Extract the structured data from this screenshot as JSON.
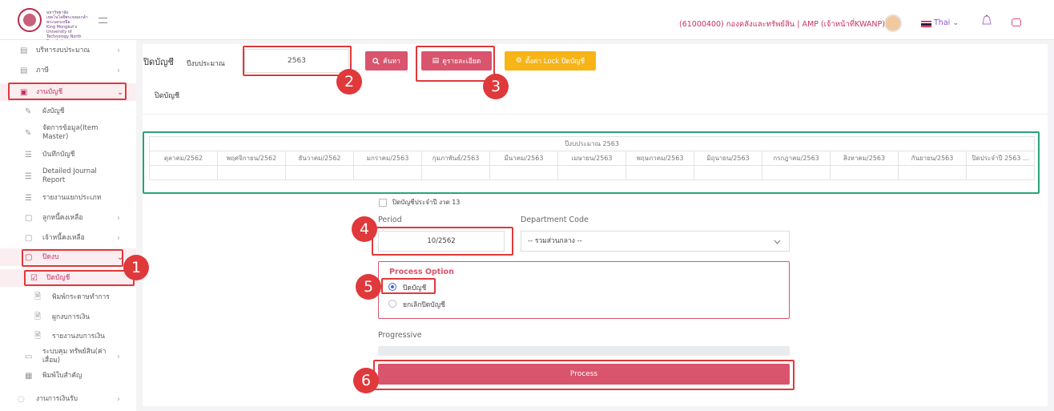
{
  "header": {
    "university_lines": [
      "มหาวิทยาลัย",
      "เทคโนโลยีพระจอมเกล้าพระนครเหนือ",
      "King Mongkut's University of",
      "Technology North Bangkok"
    ],
    "user_text": "(61000400) กองคลังและทรัพย์สิน | AMP (เจ้าหน้าที่KWANP)",
    "language": "Thai",
    "language_caret": "⌄"
  },
  "sidebar": {
    "items": [
      {
        "label": "บริหารงบประมาณ",
        "icon": "ledger-icon",
        "chevron": "›"
      },
      {
        "label": "ภาษี",
        "icon": "ledger-icon",
        "chevron": "›"
      },
      {
        "label": "งานบัญชี",
        "icon": "folder-icon",
        "chevron": "⌄"
      },
      {
        "label": "ผังบัญชี",
        "icon": "edit-doc-icon"
      },
      {
        "label": "จัดการข้อมูล(Item Master)",
        "icon": "edit-doc-icon"
      },
      {
        "label": "บันทึกบัญชี",
        "icon": "list-icon"
      },
      {
        "label": "Detailed Journal Report",
        "icon": "list-icon"
      },
      {
        "label": "รายงานแยกประเภท",
        "icon": "list-icon"
      },
      {
        "label": "ลูกหนี้คงเหลือ",
        "icon": "doc-icon",
        "chevron": "›"
      },
      {
        "label": "เจ้าหนี้คงเหลือ",
        "icon": "doc-icon",
        "chevron": "›"
      },
      {
        "label": "ปิดงบ",
        "icon": "doc-icon",
        "chevron": "⌄"
      },
      {
        "label": "ปิดบัญชี",
        "icon": "check-square-icon"
      },
      {
        "label": "พิมพ์กระดาษทำการ",
        "icon": "file-icon"
      },
      {
        "label": "ผูกงบการเงิน",
        "icon": "file-icon"
      },
      {
        "label": "รายงานงบการเงิน",
        "icon": "file-icon"
      },
      {
        "label": "ระบบคุม ทรัพย์สิน(ค่าเสื่อม)",
        "icon": "box-icon",
        "chevron": "›"
      },
      {
        "label": "พิมพ์ใบสำคัญ",
        "icon": "print-icon"
      },
      {
        "label": "งานการเงินรับ",
        "icon": "coin-icon",
        "chevron": "›"
      }
    ]
  },
  "toolbar": {
    "page_title": "ปิดบัญชี",
    "year_label": "ปีงบประมาณ",
    "year_value": "2563",
    "search_label": "ค้นหา",
    "detail_label": "ดูรายละเอียด",
    "lock_label": "ตั้งค่า Lock ปิดบัญชี"
  },
  "card": {
    "title": "ปิดบัญชี"
  },
  "table": {
    "header": "ปีงบประมาณ 2563",
    "months": [
      "ตุลาคม/2562",
      "พฤศจิกายน/2562",
      "ธันวาคม/2562",
      "มกราคม/2563",
      "กุมภาพันธ์/2563",
      "มีนาคม/2563",
      "เมษายน/2563",
      "พฤษภาคม/2563",
      "มิถุนายน/2563",
      "กรกฎาคม/2563",
      "สิงหาคม/2563",
      "กันยายน/2563",
      "ปิดประจำปี 2563 ..."
    ]
  },
  "form": {
    "period13_label": "ปิดบัญชีประจำปี งวด 13",
    "period_label": "Period",
    "period_value": "10/2562",
    "department_label": "Department Code",
    "department_value": "-- รวมส่วนกลาง --",
    "process_option_title": "Process Option",
    "options": [
      "ปิดบัญชี",
      "ยกเลิกปิดบัญชี"
    ],
    "selected_option": 0,
    "progressive_label": "Progressive",
    "progress_value": "0%",
    "process_button": "Process"
  },
  "annotations": {
    "markers": [
      "1",
      "2",
      "3",
      "4",
      "5",
      "6"
    ]
  },
  "colors": {
    "accent": "#d9546d",
    "highlight": "#e0393b",
    "green": "#2aa27b",
    "warning": "#f6b417"
  }
}
